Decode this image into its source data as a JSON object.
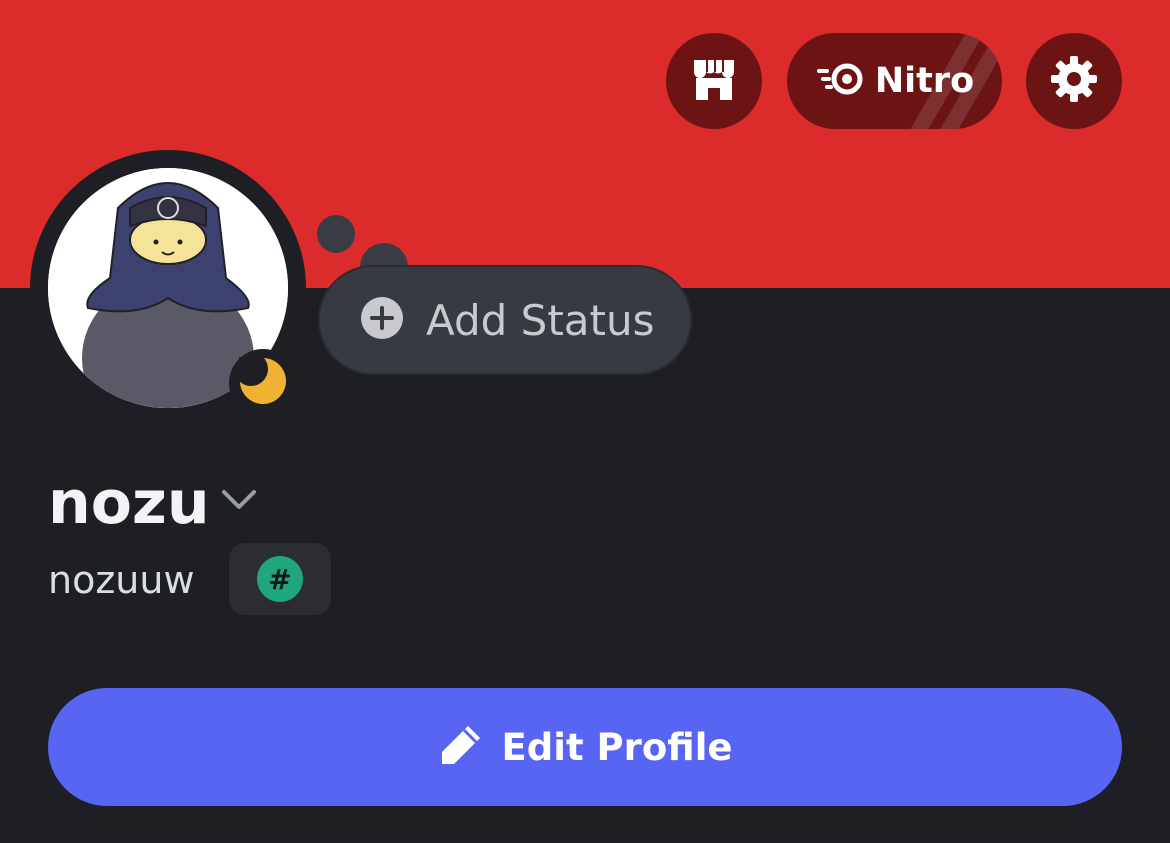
{
  "header": {
    "nitro_label": "Nitro",
    "shop_icon": "shop-icon",
    "nitro_icon": "nitro-icon",
    "settings_icon": "gear-icon"
  },
  "profile": {
    "display_name": "nozu",
    "username": "nozuuw",
    "status_placeholder": "Add Status",
    "presence": "idle",
    "badge_symbol": "#"
  },
  "actions": {
    "edit_profile_label": "Edit Profile"
  },
  "colors": {
    "banner": "#dc2b2b",
    "background": "#1e1f24",
    "accent": "#5865f2",
    "idle": "#f0b232",
    "badge": "#1fa67e"
  }
}
